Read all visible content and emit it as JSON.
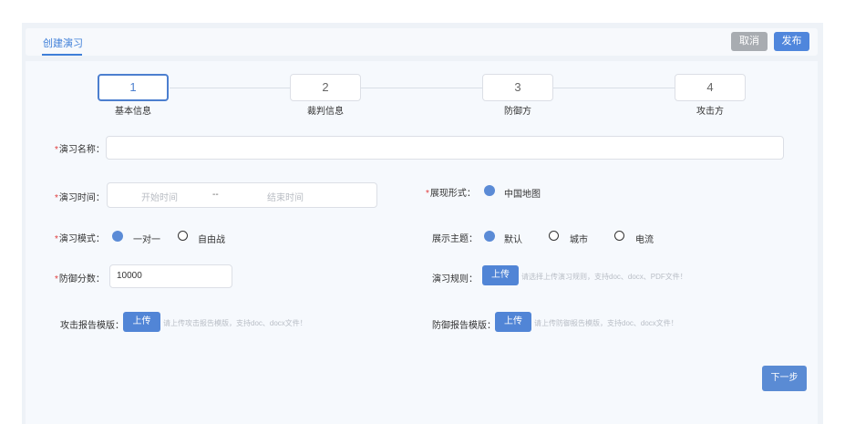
{
  "header": {
    "tab_label": "创建演习",
    "cancel_label": "取消",
    "publish_label": "发布"
  },
  "steps": [
    {
      "number": "1",
      "label": "基本信息",
      "active": true
    },
    {
      "number": "2",
      "label": "裁判信息",
      "active": false
    },
    {
      "number": "3",
      "label": "防御方",
      "active": false
    },
    {
      "number": "4",
      "label": "攻击方",
      "active": false
    }
  ],
  "form": {
    "name": {
      "label": "演习名称：",
      "value": ""
    },
    "time": {
      "label": "演习时间：",
      "start_placeholder": "开始时间",
      "separator": "--",
      "end_placeholder": "结束时间"
    },
    "display_form": {
      "label": "展现形式：",
      "option": "中国地图"
    },
    "mode": {
      "label": "演习模式：",
      "options": [
        "一对一",
        "自由战"
      ],
      "selected": "一对一"
    },
    "theme": {
      "label": "展示主题：",
      "options": [
        "默认",
        "城市",
        "电流"
      ],
      "selected": "默认"
    },
    "score": {
      "label": "防御分数：",
      "value": "10000"
    },
    "rules": {
      "label": "演习规则：",
      "button": "上传",
      "hint": "请选择上传演习规则，支持doc、docx、PDF文件！"
    },
    "attack_report": {
      "label": "攻击报告模版：",
      "button": "上传",
      "hint": "请上传攻击报告模版，支持doc、docx文件！"
    },
    "defense_report": {
      "label": "防御报告模版：",
      "button": "上传",
      "hint": "请上传防御报告模版，支持doc、docx文件！"
    }
  },
  "footer": {
    "next_label": "下一步"
  },
  "colors": {
    "accent": "#4f86dc",
    "required": "#e03a3a",
    "cancel": "#a8acb1"
  }
}
